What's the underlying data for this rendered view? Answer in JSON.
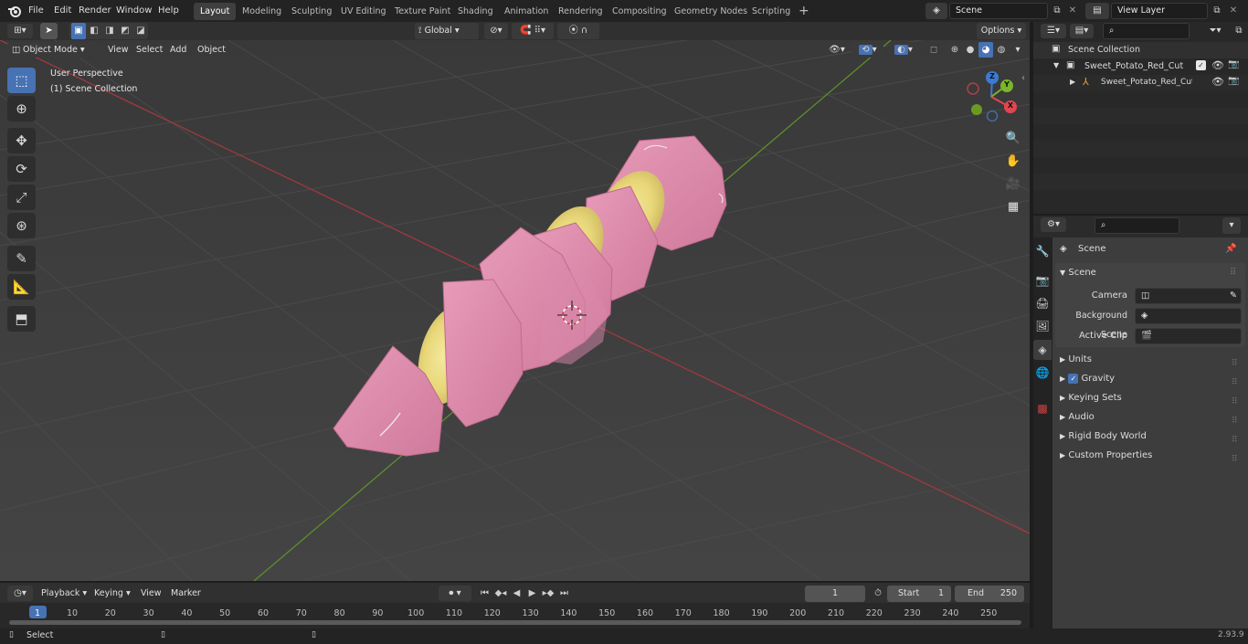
{
  "menu": [
    "File",
    "Edit",
    "Render",
    "Window",
    "Help"
  ],
  "workspaces": [
    "Layout",
    "Modeling",
    "Sculpting",
    "UV Editing",
    "Texture Paint",
    "Shading",
    "Animation",
    "Rendering",
    "Compositing",
    "Geometry Nodes",
    "Scripting"
  ],
  "active_workspace": "Layout",
  "scene_field": "Scene",
  "view_layer_field": "View Layer",
  "viewport_header": {
    "mode": "Object Mode",
    "menus": [
      "View",
      "Select",
      "Add",
      "Object"
    ],
    "transform_orientation": "Global",
    "options": "Options"
  },
  "overlay": {
    "line1": "User Perspective",
    "line2": "(1) Scene Collection"
  },
  "gizmo": {
    "z": "Z",
    "y": "Y",
    "x": "X"
  },
  "outliner": {
    "root": "Scene Collection",
    "collection": "Sweet_Potato_Red_Cut",
    "object": "Sweet_Potato_Red_Cut_("
  },
  "properties": {
    "context": "Scene",
    "panel": "Scene",
    "camera_label": "Camera",
    "background_scene_label": "Background Scene",
    "active_clip_label": "Active Clip",
    "sections": [
      "Units",
      "Gravity",
      "Keying Sets",
      "Audio",
      "Rigid Body World",
      "Custom Properties"
    ],
    "gravity_checked": true
  },
  "timeline": {
    "menus": [
      "Playback",
      "Keying",
      "View",
      "Marker"
    ],
    "current_frame": "1",
    "start_label": "Start",
    "start_value": "1",
    "end_label": "End",
    "end_value": "250",
    "ticks": [
      "1",
      "10",
      "20",
      "30",
      "40",
      "50",
      "60",
      "70",
      "80",
      "90",
      "100",
      "110",
      "120",
      "130",
      "140",
      "150",
      "160",
      "170",
      "180",
      "190",
      "200",
      "210",
      "220",
      "230",
      "240",
      "250"
    ]
  },
  "status": {
    "left": "Select",
    "version": "2.93.9"
  },
  "colors": {
    "accent": "#4772b3",
    "x_axis": "#e0464f",
    "y_axis": "#7ab52a",
    "z_axis": "#3b7bd4"
  }
}
